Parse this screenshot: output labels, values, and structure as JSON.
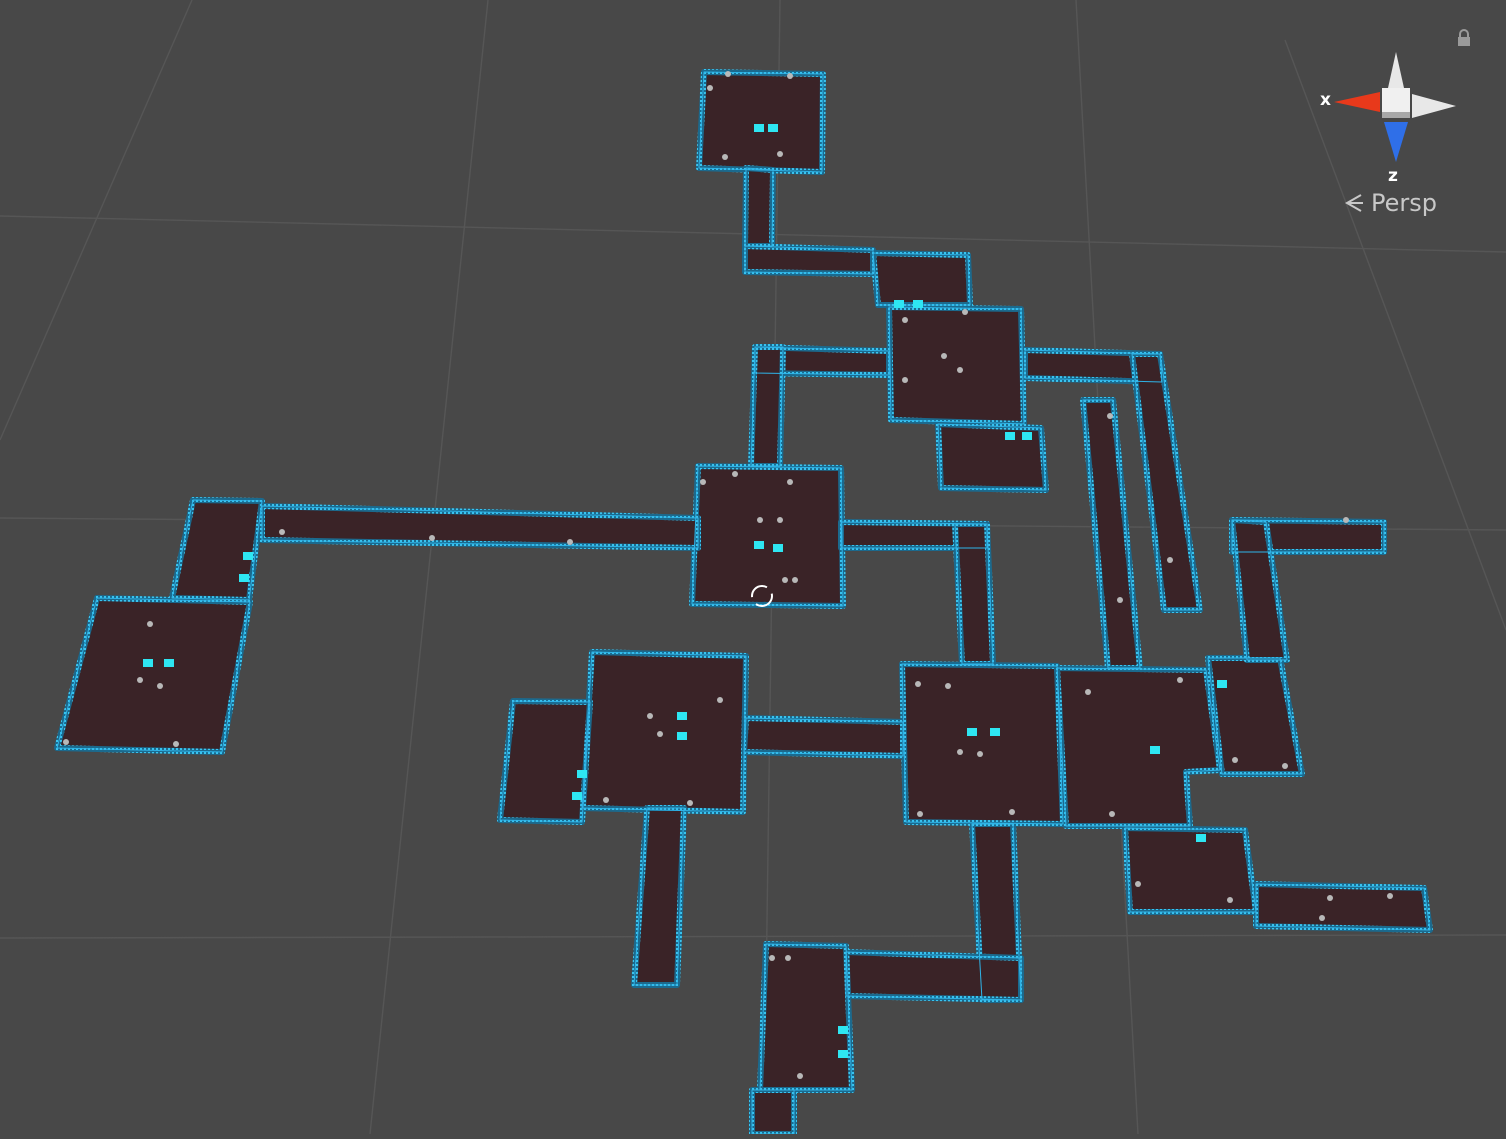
{
  "scene_view": {
    "projection_label": "Persp",
    "background_color": "#484848",
    "grid_color": "#565656",
    "floor_color": "#3a2327",
    "wall_outline_color": "#2fb4e8",
    "wall_inner_color": "#155a78",
    "prop_accent_color": "#2ee6f2"
  },
  "gizmo": {
    "x_label": "x",
    "z_label": "z",
    "x_axis_color": "#e8391b",
    "z_axis_color": "#2f6fe8",
    "neutral_axis_color": "#e8e8e8"
  },
  "icons": {
    "lock": "lock-icon",
    "persp_arrow": "chevron-left-icon"
  }
}
